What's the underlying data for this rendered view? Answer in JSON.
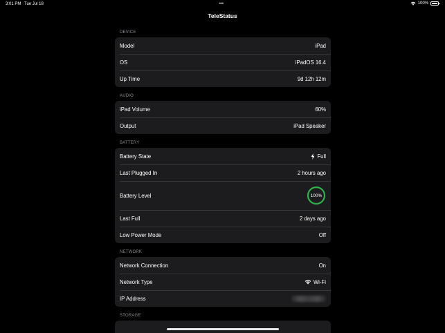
{
  "status_bar": {
    "time": "3:01 PM",
    "date": "Tue Jul 18",
    "battery_percent": "100%",
    "dots": "•••"
  },
  "nav": {
    "title": "TeleStatus"
  },
  "device": {
    "header": "DEVICE",
    "model_label": "Model",
    "model_value": "iPad",
    "os_label": "OS",
    "os_value": "iPadOS 16.4",
    "uptime_label": "Up Time",
    "uptime_value": "9d 12h 12m"
  },
  "audio": {
    "header": "AUDIO",
    "volume_label": "iPad Volume",
    "volume_value": "60%",
    "output_label": "Output",
    "output_value": "iPad Speaker"
  },
  "battery": {
    "header": "BATTERY",
    "state_label": "Battery State",
    "state_value": "Full",
    "plugged_label": "Last Plugged In",
    "plugged_value": "2 hours ago",
    "level_label": "Battery Level",
    "level_value": "100%",
    "level_fraction": 1.0,
    "last_full_label": "Last Full",
    "last_full_value": "2 days ago",
    "low_power_label": "Low Power Mode",
    "low_power_value": "Off"
  },
  "network": {
    "header": "NETWORK",
    "connection_label": "Network Connection",
    "connection_value": "On",
    "type_label": "Network Type",
    "type_value": "Wi-Fi",
    "ip_label": "IP Address"
  },
  "storage": {
    "header": "STORAGE"
  },
  "colors": {
    "background": "#000000",
    "cell": "#1c1c1e",
    "secondary_text": "#8d8d93",
    "ring_green": "#30b14c"
  }
}
